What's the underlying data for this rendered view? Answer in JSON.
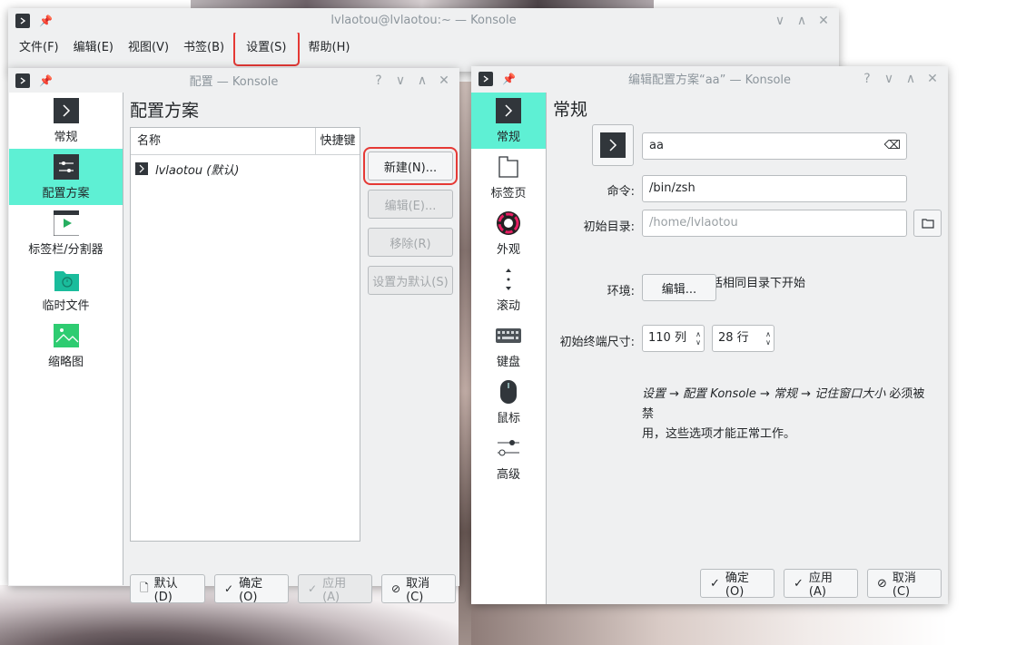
{
  "main_window": {
    "title": "lvlaotou@lvlaotou:~ — Konsole",
    "menu": [
      {
        "label": "文件(F)",
        "highlighted": false
      },
      {
        "label": "编辑(E)",
        "highlighted": false
      },
      {
        "label": "视图(V)",
        "highlighted": false
      },
      {
        "label": "书签(B)",
        "highlighted": false
      },
      {
        "label": "设置(S)",
        "highlighted": true
      },
      {
        "label": "帮助(H)",
        "highlighted": false
      }
    ]
  },
  "config_window": {
    "title": "配置 — Konsole",
    "sidebar": [
      {
        "label": "常规",
        "icon": "terminal-icon",
        "active": false
      },
      {
        "label": "配置方案",
        "icon": "sliders-icon",
        "active": true
      },
      {
        "label": "标签栏/分割器",
        "icon": "tabbar-icon",
        "active": false
      },
      {
        "label": "临时文件",
        "icon": "folder-clock-icon",
        "active": false
      },
      {
        "label": "缩略图",
        "icon": "image-icon",
        "active": false
      }
    ],
    "section_title": "配置方案",
    "list": {
      "col_name": "名称",
      "col_shortcut": "快捷键",
      "rows": [
        {
          "name": "lvlaotou (默认)"
        }
      ]
    },
    "buttons": {
      "new": "新建(N)...",
      "edit": "编辑(E)...",
      "remove": "移除(R)",
      "set_default": "设置为默认(S)"
    },
    "bottom": {
      "defaults": "默认(D)",
      "ok": "确定(O)",
      "apply": "应用(A)",
      "cancel": "取消(C)"
    }
  },
  "edit_window": {
    "title": "编辑配置方案“aa” — Konsole",
    "sidebar": [
      {
        "label": "常规",
        "icon": "terminal-icon",
        "active": true
      },
      {
        "label": "标签页",
        "icon": "tab-icon",
        "active": false
      },
      {
        "label": "外观",
        "icon": "color-wheel-icon",
        "active": false
      },
      {
        "label": "滚动",
        "icon": "scroll-icon",
        "active": false
      },
      {
        "label": "键盘",
        "icon": "keyboard-icon",
        "active": false
      },
      {
        "label": "鼠标",
        "icon": "mouse-icon",
        "active": false
      },
      {
        "label": "高级",
        "icon": "advanced-sliders-icon",
        "active": false
      }
    ],
    "section_title": "常规",
    "profile_name": "aa",
    "command_label": "命令:",
    "command_value": "/bin/zsh",
    "initdir_label": "初始目录:",
    "initdir_placeholder": "/home/lvlaotou",
    "same_dir_checkbox": "在当前会话相同目录下开始",
    "env_label": "环境:",
    "env_button": "编辑...",
    "size_label": "初始终端尺寸:",
    "columns": "110 列",
    "rows": "28 行",
    "note_italic": "设置 → 配置 Konsole → 常规 → 记住窗口大小",
    "note_plain_1": " 必须被禁",
    "note_plain_2": "用，这些选项才能正常工作。",
    "bottom": {
      "ok": "确定(O)",
      "apply": "应用(A)",
      "cancel": "取消(C)"
    }
  }
}
